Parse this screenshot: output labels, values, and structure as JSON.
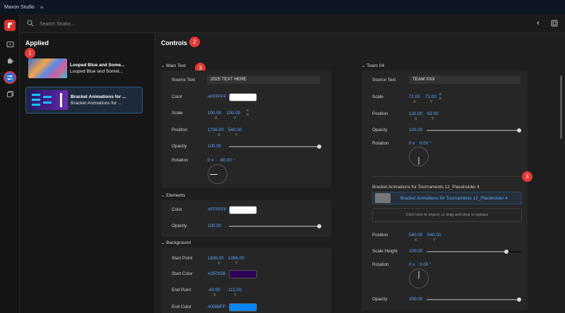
{
  "app": {
    "title": "Maxon Studio",
    "menu_icon": "hamburger-icon"
  },
  "search": {
    "placeholder": "Search Studio..."
  },
  "nav": {
    "back": "‹",
    "items": [
      {
        "name": "logo-icon"
      },
      {
        "name": "media-icon"
      },
      {
        "name": "extensions-icon"
      },
      {
        "name": "controls-icon",
        "active": true
      },
      {
        "name": "library-icon"
      }
    ]
  },
  "applied": {
    "title": "Applied",
    "cards": [
      {
        "title": "Looped Blue and Some...",
        "subtitle": "Looped Blue and Somet..."
      },
      {
        "title": "Bracket Animations for ...",
        "subtitle": "Bracket Animations for ..."
      }
    ]
  },
  "controls": {
    "title": "Controls",
    "main_text": {
      "header": "Main Text",
      "source_label": "Source Text",
      "source_value": "2025 TEXT HERE",
      "color_label": "Color",
      "color_value": "#FFFFFF",
      "scale_label": "Scale",
      "scale_x": "100.00",
      "scale_y": "100.00",
      "position_label": "Position",
      "pos_x": "1736.00",
      "pos_y": "540.00",
      "opacity_label": "Opacity",
      "opacity_value": "100.00",
      "rotation_label": "Rotation",
      "rot_turns": "0 x",
      "rot_deg": "-90.00 °"
    },
    "elements": {
      "header": "Elements",
      "color_label": "Color",
      "color_value": "#FFFFFF",
      "opacity_label": "Opacity",
      "opacity_value": "100.00"
    },
    "background": {
      "header": "Background",
      "start_point_label": "Start Point",
      "start_x": "1836.00",
      "start_y": "1096.00",
      "start_color_label": "Start Color",
      "start_color": "#2E0058",
      "end_point_label": "End Point",
      "end_x": "-40.00",
      "end_y": "-112.00",
      "end_color_label": "End Color",
      "end_color": "#0088FF"
    },
    "team": {
      "header": "Team 04",
      "source_label": "Source Text",
      "source_value": "TEAM XXX",
      "scale_label": "Scale",
      "scale_x": "71.00",
      "scale_y": "71.00",
      "position_label": "Position",
      "pos_x": "131.00",
      "pos_y": "63.00",
      "opacity_label": "Opacity",
      "opacity_value": "100.00",
      "rotation_label": "Rotation",
      "rot_turns": "0 x",
      "rot_deg": "0.00 °"
    },
    "placeholder": {
      "title": "Bracket Animations for Tournaments 12_Placeholder 4",
      "file_name": "Bracket Animations for Tournaments 12_Placeholder 4",
      "drop_hint": "Click here to import, or drag and drop to replace",
      "position_label": "Position",
      "pos_x": "540.00",
      "pos_y": "540.00",
      "scale_height_label": "Scale Height",
      "scale_height_value": "100.00",
      "rotation_label": "Rotation",
      "rot_turns": "0 x",
      "rot_deg": "0.00 °",
      "opacity_label": "Opacity",
      "opacity_value": "100.00"
    }
  },
  "axis": {
    "x": "X",
    "y": "Y"
  },
  "badges": {
    "one": "1",
    "two": "2",
    "three": "3"
  },
  "colors": {
    "accent": "#e53935",
    "link": "#5aa7ff",
    "purple": "#2E0058",
    "blue": "#0088FF"
  }
}
